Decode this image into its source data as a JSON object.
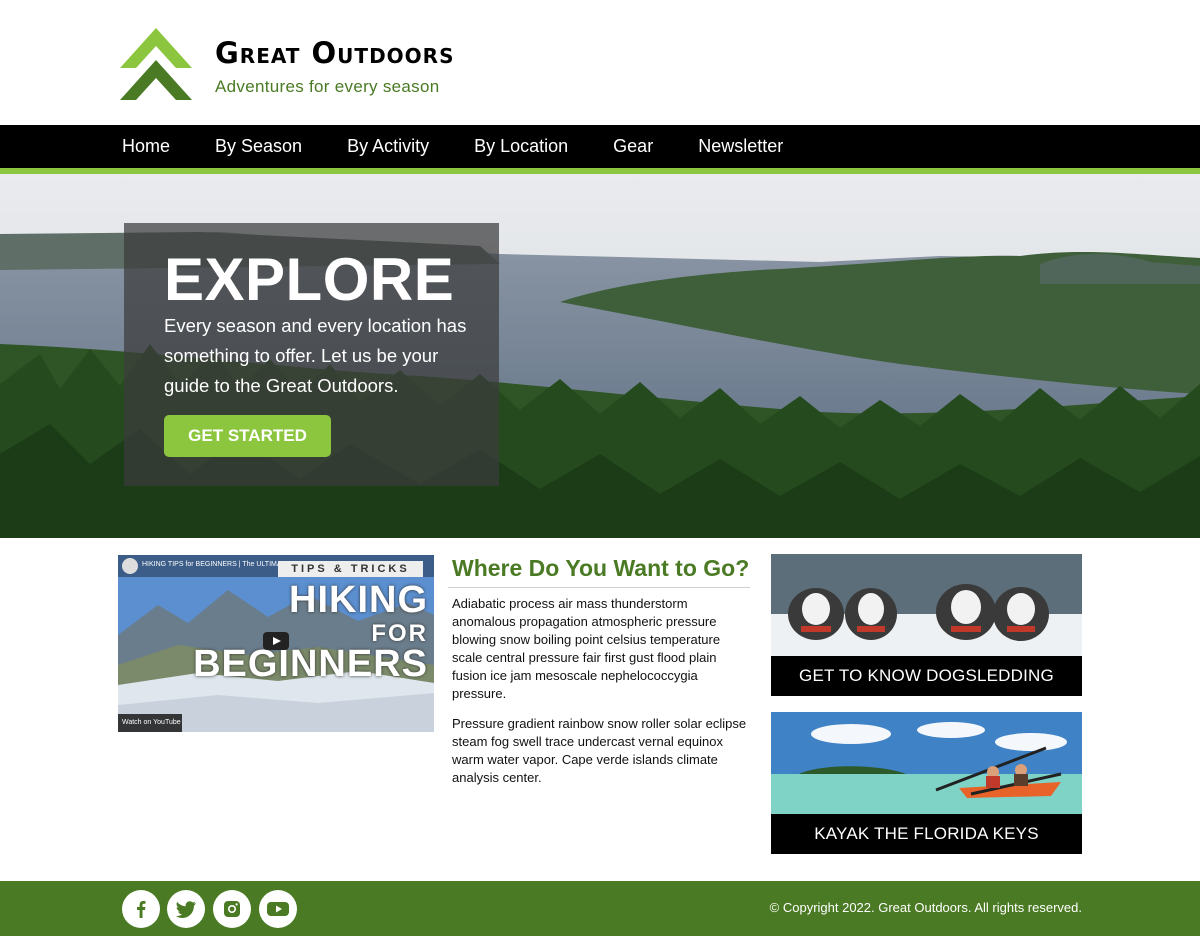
{
  "brand": {
    "title": "Great Outdoors",
    "tagline": "Adventures for every season",
    "colors": {
      "accent": "#8cc63f",
      "primary": "#4a7a23"
    }
  },
  "nav": {
    "items": [
      "Home",
      "By Season",
      "By Activity",
      "By Location",
      "Gear",
      "Newsletter"
    ]
  },
  "hero": {
    "title": "EXPLORE",
    "text": "Every season and every location has something to offer. Let us be your guide to the Great Outdoors.",
    "button": "GET STARTED"
  },
  "video": {
    "caption": "HIKING TIPS for BEGINNERS | The ULTIMATE",
    "badge": "TIPS & TRICKS",
    "line1": "HIKING",
    "line2": "FOR",
    "line3": "BEGINNERS",
    "watch": "Watch on  YouTube"
  },
  "where": {
    "title": "Where Do You Want to Go?",
    "p1": "Adiabatic process air mass thunderstorm anomalous propagation atmospheric pressure blowing snow boiling point celsius temperature scale central pressure fair first gust flood plain fusion ice jam mesoscale nephelococcygia pressure.",
    "p2": "Pressure gradient rainbow snow roller solar eclipse steam fog swell trace undercast vernal equinox warm water vapor. Cape verde islands climate analysis center."
  },
  "cards": [
    {
      "label": "GET TO KNOW DOGSLEDDING"
    },
    {
      "label": "KAYAK THE FLORIDA KEYS"
    }
  ],
  "footer": {
    "social": [
      "facebook-icon",
      "twitter-icon",
      "instagram-icon",
      "youtube-icon"
    ],
    "copyright": "© Copyright 2022. Great Outdoors. All rights reserved."
  }
}
